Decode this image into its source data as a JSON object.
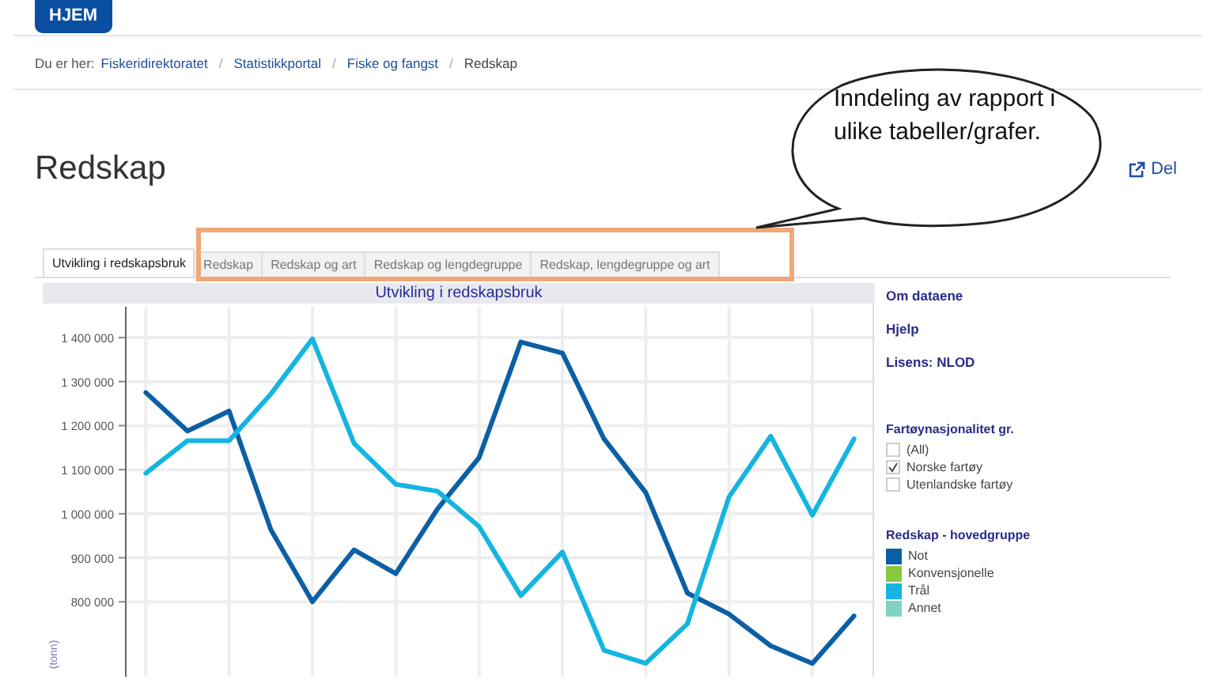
{
  "header": {
    "home_button": "HJEM"
  },
  "breadcrumb": {
    "label": "Du er her:",
    "links": [
      "Fiskeridirektoratet",
      "Statistikkportal",
      "Fiske og fangst"
    ],
    "separator": "/",
    "current": "Redskap"
  },
  "page_title": "Redskap",
  "share_link": "Del",
  "callout": {
    "text": "Inndeling av rapport i ulike tabeller/grafer."
  },
  "tabs": [
    {
      "label": "Utvikling i redskapsbruk",
      "selected": true
    },
    {
      "label": "Redskap",
      "selected": false
    },
    {
      "label": "Redskap og art",
      "selected": false
    },
    {
      "label": "Redskap og lengdegruppe",
      "selected": false
    },
    {
      "label": "Redskap, lengdegruppe og art",
      "selected": false
    }
  ],
  "chart": {
    "chart_data": {
      "type": "line",
      "title": "Utvikling i redskapsbruk",
      "ylabel": "(tonn)",
      "ylim": [
        630000,
        1470000
      ],
      "grid": true,
      "yticks": [
        {
          "value": 800000,
          "label": "800 000"
        },
        {
          "value": 900000,
          "label": "900 000"
        },
        {
          "value": 1000000,
          "label": "1 000 000"
        },
        {
          "value": 1100000,
          "label": "1 100 000"
        },
        {
          "value": 1200000,
          "label": "1 200 000"
        },
        {
          "value": 1300000,
          "label": "1 300 000"
        },
        {
          "value": 1400000,
          "label": "1 400 000"
        }
      ],
      "series": [
        {
          "color": "#0b5fa5",
          "values": [
            1275000,
            1188000,
            1233000,
            964000,
            800000,
            918000,
            864000,
            1011000,
            1127000,
            1390000,
            1365000,
            1170000,
            1048000,
            820000,
            772000,
            700000,
            660000,
            768000
          ]
        },
        {
          "color": "#14b5e0",
          "values": [
            1092000,
            1166000,
            1166000,
            1272000,
            1397000,
            1160000,
            1067000,
            1051000,
            971000,
            814000,
            913000,
            690000,
            660000,
            750000,
            1038000,
            1176000,
            997000,
            1170000
          ]
        }
      ]
    }
  },
  "sidebar": {
    "links": [
      "Om dataene",
      "Hjelp",
      "Lisens: NLOD"
    ],
    "filter": {
      "title": "Fartøynasjonalitet gr.",
      "options": [
        {
          "label": "(All)",
          "checked": false
        },
        {
          "label": "Norske fartøy",
          "checked": true
        },
        {
          "label": "Utenlandske fartøy",
          "checked": false
        }
      ]
    },
    "legend": {
      "title": "Redskap - hovedgruppe",
      "items": [
        {
          "label": "Not",
          "color": "#0b5fa5"
        },
        {
          "label": "Konvensjonelle",
          "color": "#8dc63f"
        },
        {
          "label": "Trål",
          "color": "#14b5e0"
        },
        {
          "label": "Annet",
          "color": "#7fd3c0"
        }
      ]
    }
  }
}
